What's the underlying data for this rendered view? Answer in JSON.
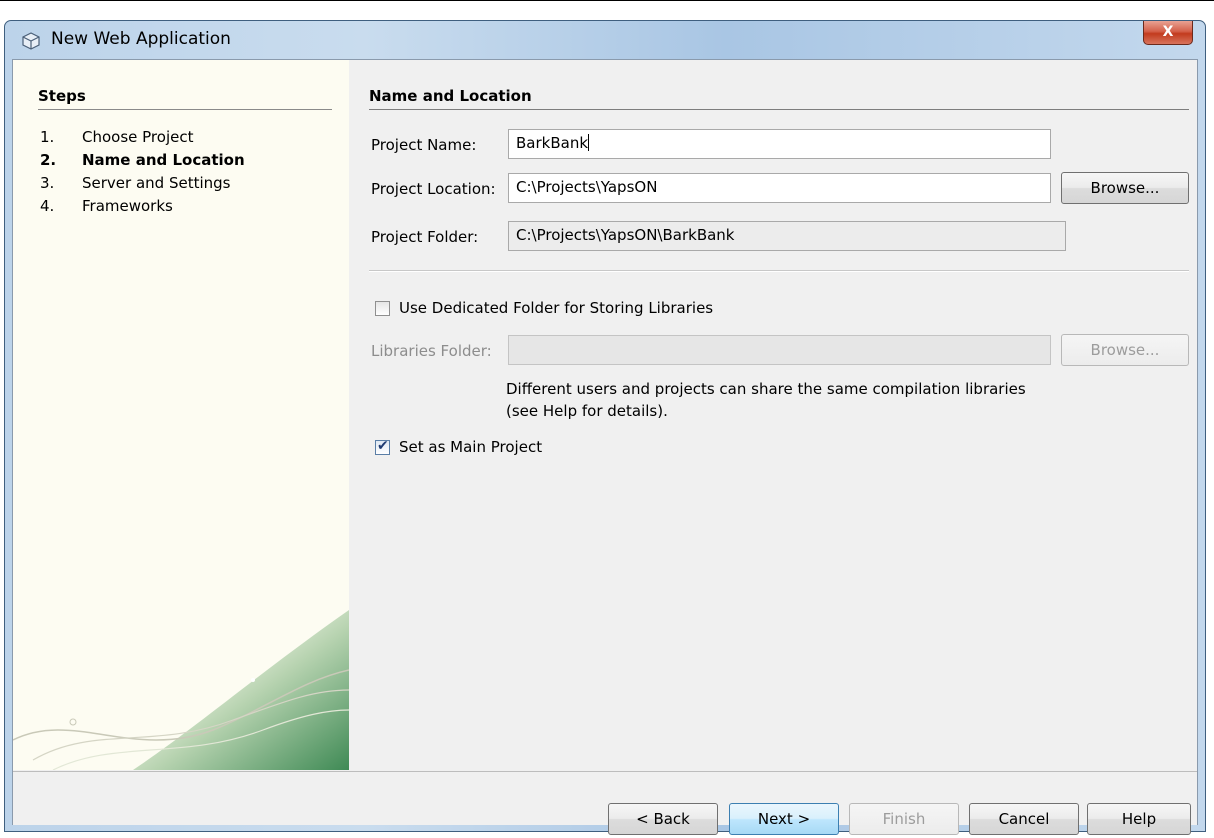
{
  "window": {
    "title": "New Web Application",
    "close_glyph": "X",
    "icon": "app-cube-icon"
  },
  "steps": {
    "heading": "Steps",
    "items": [
      {
        "num": "1.",
        "label": "Choose Project",
        "current": false
      },
      {
        "num": "2.",
        "label": "Name and Location",
        "current": true
      },
      {
        "num": "3.",
        "label": "Server and Settings",
        "current": false
      },
      {
        "num": "4.",
        "label": "Frameworks",
        "current": false
      }
    ]
  },
  "panel": {
    "heading": "Name and Location",
    "project_name": {
      "label": "Project Name:",
      "value": "BarkBank"
    },
    "project_location": {
      "label": "Project Location:",
      "value": "C:\\Projects\\YapsON",
      "browse": "Browse..."
    },
    "project_folder": {
      "label": "Project Folder:",
      "value": "C:\\Projects\\YapsON\\BarkBank"
    },
    "dedicated_folder": {
      "label": "Use Dedicated Folder for Storing Libraries",
      "checked": false
    },
    "libraries_folder": {
      "label": "Libraries Folder:",
      "value": "",
      "browse": "Browse..."
    },
    "libraries_help_line1": "Different users and projects can share the same compilation libraries",
    "libraries_help_line2": "(see Help for details).",
    "main_project": {
      "label": "Set as Main Project",
      "checked": true
    }
  },
  "footer": {
    "back": "< Back",
    "next": "Next >",
    "finish": "Finish",
    "cancel": "Cancel",
    "help": "Help"
  },
  "colors": {
    "steps_background": "#fdfcf2",
    "panel_background": "#f0f0f0",
    "close_button": "#c23b1e"
  }
}
